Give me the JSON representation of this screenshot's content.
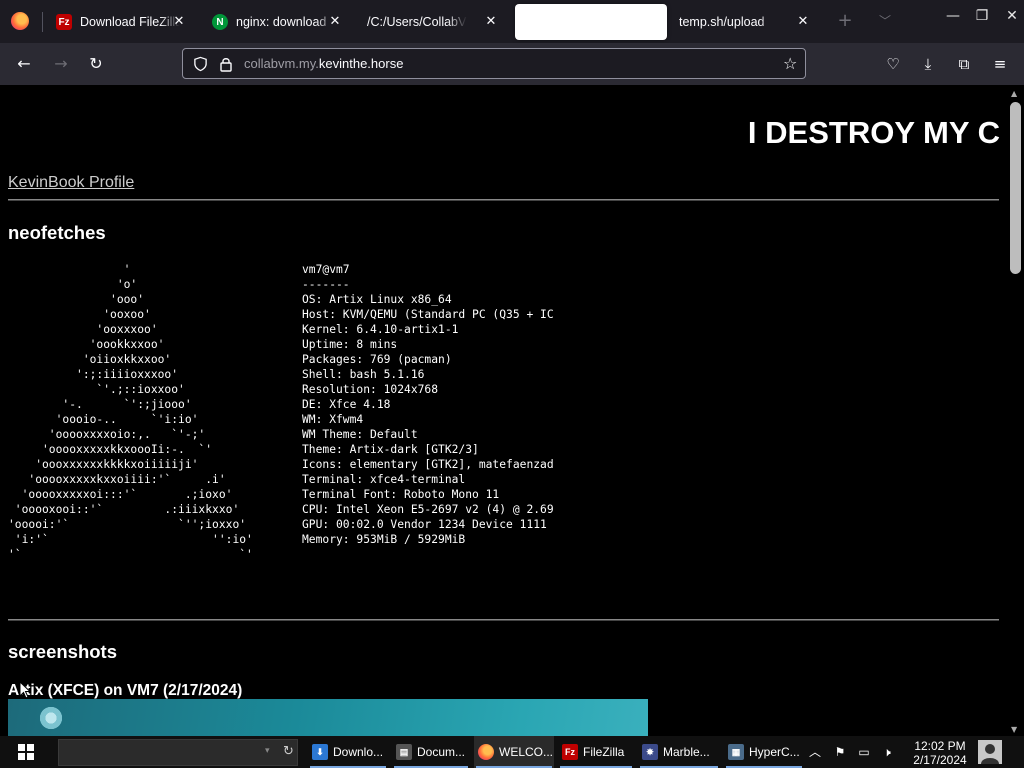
{
  "browser": {
    "tabs": [
      {
        "title": "Download FileZilla",
        "icon_text": "Fz",
        "icon_color": "#bf0000"
      },
      {
        "title": "nginx: download",
        "icon_text": "N",
        "icon_color": "#009639"
      },
      {
        "title": "/C:/Users/CollabVM/D",
        "icon_text": "",
        "icon_color": ""
      },
      {
        "title": "",
        "icon_text": "",
        "icon_color": ""
      },
      {
        "title": "temp.sh/upload",
        "icon_text": "",
        "icon_color": ""
      }
    ],
    "url_dim": "collabvm.my.",
    "url_host": "kevinthe.horse"
  },
  "page": {
    "banner": "I DESTROY MY C",
    "profile_link": "KevinBook Profile",
    "neofetches_title": "neofetches",
    "neofetch_art": "                 '\n                'o'\n               'ooo'\n              'ooxoo'\n             'ooxxxoo'\n            'oookkxxoo'\n           'oiioxkkxxoo'\n          ':;:iiiioxxxoo'\n             `'.;::ioxxoo'\n        '-.      `':;jiooo'\n       'oooio-..     `'i:io'\n      'ooooxxxxoio:,.   `'-;'\n     'ooooxxxxxkkxoooIi:-.  `'\n    'oooxxxxxxkkkkxoiiiiiji'\n   'ooooxxxxxkxxoiiii:'`     .i'\n  'ooooxxxxxoi:::'`       .;ioxo'\n 'ooooxooi::'`         .:iiixkxxo'\n'ooooi:'`                `'';ioxxo'\n 'i:'`                        '':io'\n'`                                `'",
    "neofetch_info": "vm7@vm7\n-------\nOS: Artix Linux x86_64\nHost: KVM/QEMU (Standard PC (Q35 + IC\nKernel: 6.4.10-artix1-1\nUptime: 8 mins\nPackages: 769 (pacman)\nShell: bash 5.1.16\nResolution: 1024x768\nDE: Xfce 4.18\nWM: Xfwm4\nWM Theme: Default\nTheme: Artix-dark [GTK2/3]\nIcons: elementary [GTK2], matefaenzad\nTerminal: xfce4-terminal\nTerminal Font: Roboto Mono 11\nCPU: Intel Xeon E5-2697 v2 (4) @ 2.69\nGPU: 00:02.0 Vendor 1234 Device 1111\nMemory: 953MiB / 5929MiB",
    "screenshots_title": "screenshots",
    "screenshot_caption": "Artix (XFCE) on VM7 (2/17/2024)"
  },
  "taskbar": {
    "items": [
      {
        "label": "Downlo...",
        "icon_text": "⬇",
        "icon_color": "#2b78d4"
      },
      {
        "label": "Docum...",
        "icon_text": "▤",
        "icon_color": "#555555"
      },
      {
        "label": "WELCO...",
        "icon_text": "",
        "icon_color": "#ff7139"
      },
      {
        "label": "FileZilla",
        "icon_text": "Fz",
        "icon_color": "#bf0000"
      },
      {
        "label": "Marble...",
        "icon_text": "✸",
        "icon_color": "#3b4a8a"
      },
      {
        "label": "HyperC...",
        "icon_text": "▦",
        "icon_color": "#4a6b8a"
      }
    ],
    "time": "12:02 PM",
    "date": "2/17/2024"
  }
}
